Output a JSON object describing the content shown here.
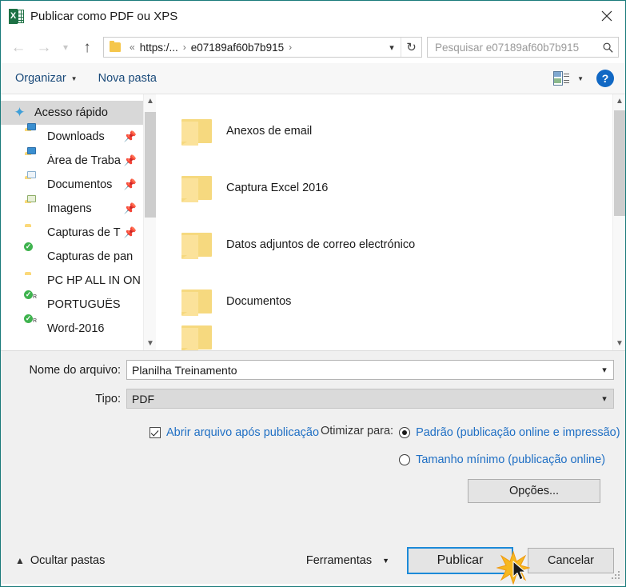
{
  "window": {
    "title": "Publicar como PDF ou XPS",
    "app_icon": "excel-icon",
    "close_icon": "close-icon",
    "border_color": "#1a7a7a"
  },
  "nav": {
    "back_icon": "back-arrow-icon",
    "forward_icon": "forward-arrow-icon",
    "history_icon": "chevron-down-icon",
    "up_icon": "up-arrow-icon",
    "address": {
      "folder_icon": "folder-icon",
      "overflow": "«",
      "segments": [
        "https:/...",
        "e07189af60b7b915"
      ],
      "separator": "›",
      "dropdown_icon": "chevron-down-icon",
      "refresh_icon": "refresh-icon"
    },
    "search": {
      "placeholder": "Pesquisar e07189af60b7b915",
      "icon": "search-icon"
    }
  },
  "toolbar": {
    "organize_label": "Organizar",
    "new_folder_label": "Nova pasta",
    "view_icon": "view-layout-icon",
    "view_caret_icon": "chevron-down-icon",
    "help_icon": "help-icon",
    "help_label": "?"
  },
  "sidebar": {
    "items": [
      {
        "label": "Acesso rápido",
        "icon": "star-icon",
        "selected": true,
        "pinned": false,
        "indent": false
      },
      {
        "label": "Downloads",
        "icon": "folder-download-icon",
        "selected": false,
        "pinned": true,
        "indent": true
      },
      {
        "label": "Área de Traba",
        "icon": "folder-desktop-icon",
        "selected": false,
        "pinned": true,
        "indent": true
      },
      {
        "label": "Documentos",
        "icon": "folder-documents-icon",
        "selected": false,
        "pinned": true,
        "indent": true
      },
      {
        "label": "Imagens",
        "icon": "folder-pictures-icon",
        "selected": false,
        "pinned": true,
        "indent": true
      },
      {
        "label": "Capturas de T",
        "icon": "folder-icon",
        "selected": false,
        "pinned": true,
        "indent": true
      },
      {
        "label": "Capturas de pan",
        "icon": "folder-synced-icon",
        "selected": false,
        "pinned": false,
        "indent": true
      },
      {
        "label": "PC HP ALL IN ON",
        "icon": "folder-icon",
        "selected": false,
        "pinned": false,
        "indent": true
      },
      {
        "label": "PORTUGUÊS",
        "icon": "folder-synced-r-icon",
        "selected": false,
        "pinned": false,
        "indent": true
      },
      {
        "label": "Word-2016",
        "icon": "folder-synced-r-icon",
        "selected": false,
        "pinned": false,
        "indent": true
      }
    ],
    "scroll_up_icon": "chevron-up-icon",
    "scroll_down_icon": "chevron-down-icon"
  },
  "filelist": {
    "items": [
      {
        "name": "Anexos de email",
        "icon": "folder-icon"
      },
      {
        "name": "Captura Excel 2016",
        "icon": "folder-icon"
      },
      {
        "name": "Datos adjuntos de correo electrónico",
        "icon": "folder-icon"
      },
      {
        "name": "Documentos",
        "icon": "folder-icon"
      }
    ],
    "scroll_up_icon": "chevron-up-icon",
    "scroll_down_icon": "chevron-down-icon"
  },
  "form": {
    "filename_label": "Nome do arquivo:",
    "filename_value": "Planilha Treinamento",
    "filetype_label": "Tipo:",
    "filetype_value": "PDF",
    "dropdown_icon": "chevron-down-icon",
    "open_after_publish": {
      "label": "Abrir arquivo após publicação",
      "checked": true,
      "icon": "checkbox-icon"
    },
    "optimize": {
      "title": "Otimizar para:",
      "options": [
        {
          "label": "Padrão (publicação online e impressão)",
          "selected": true
        },
        {
          "label": "Tamanho mínimo (publicação online)",
          "selected": false
        }
      ]
    },
    "options_button": "Opções..."
  },
  "footer": {
    "hide_folders_label": "Ocultar pastas",
    "hide_folders_icon": "chevron-up-icon",
    "tools_label": "Ferramentas",
    "tools_icon": "chevron-down-icon",
    "publish_button": "Publicar",
    "cancel_button": "Cancelar",
    "resize_grip_icon": "resize-grip-icon",
    "cursor_icon": "mouse-cursor-icon",
    "click_burst_icon": "click-burst-icon"
  },
  "colors": {
    "accent_blue": "#1f6fc4",
    "focus_border": "#1c8ad8",
    "folder_yellow": "#fbd97a",
    "window_border": "#1a7a7a",
    "excel_green": "#1e7145"
  }
}
